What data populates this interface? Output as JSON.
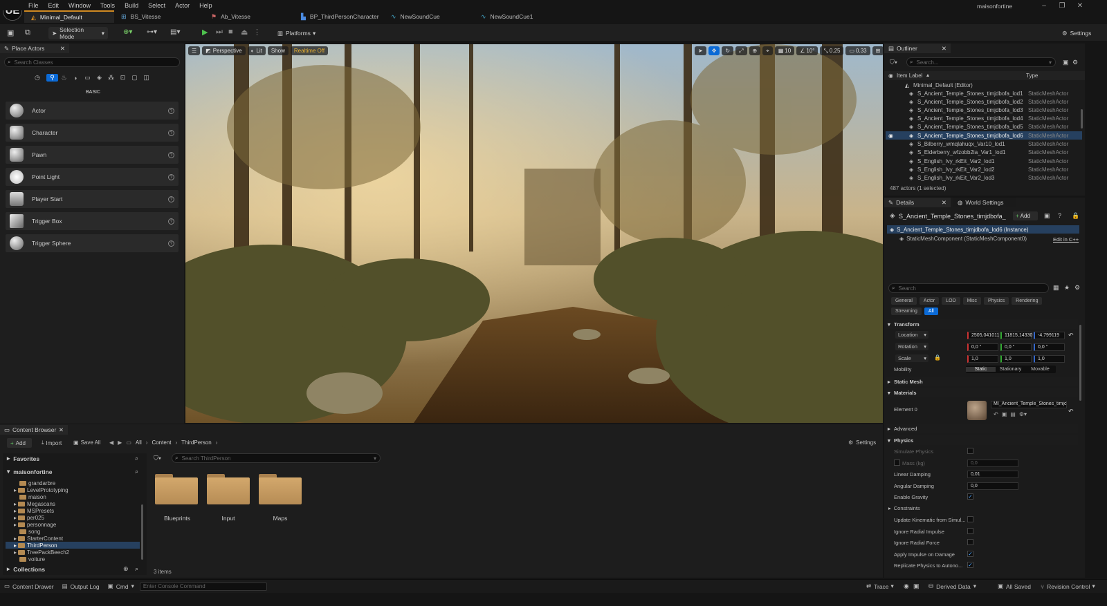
{
  "window": {
    "project_name": "maisonfortine",
    "logo": "UE"
  },
  "menu": [
    "File",
    "Edit",
    "Window",
    "Tools",
    "Build",
    "Select",
    "Actor",
    "Help"
  ],
  "tabs": [
    {
      "label": "Minimal_Default",
      "icon": "level-icon",
      "active": true
    },
    {
      "label": "BS_Vitesse",
      "icon": "blendspace-icon",
      "active": false
    },
    {
      "label": "Ab_Vitesse",
      "icon": "animblueprint-icon",
      "active": false
    },
    {
      "label": "BP_ThirdPersonCharacter",
      "icon": "blueprint-icon",
      "active": false
    },
    {
      "label": "NewSoundCue",
      "icon": "soundcue-icon",
      "active": false
    },
    {
      "label": "NewSoundCue1",
      "icon": "soundcue-icon",
      "active": false
    }
  ],
  "toolbar": {
    "selection_mode": "Selection Mode",
    "platforms": "Platforms",
    "settings": "Settings"
  },
  "place_actors": {
    "title": "Place Actors",
    "search_placeholder": "Search Classes",
    "category": "BASIC",
    "items": [
      "Actor",
      "Character",
      "Pawn",
      "Point Light",
      "Player Start",
      "Trigger Box",
      "Trigger Sphere"
    ]
  },
  "viewport": {
    "perspective": "Perspective",
    "lit": "Lit",
    "show": "Show",
    "realtime": "Realtime Off",
    "grid": "10",
    "angle": "10°",
    "scale": "0.25",
    "camera": "0.33"
  },
  "outliner": {
    "title": "Outliner",
    "search_placeholder": "Search...",
    "col_label": "Item Label",
    "col_type": "Type",
    "root": "Minimal_Default (Editor)",
    "rows": [
      {
        "label": "S_Ancient_Temple_Stones_timjdbofa_lod1",
        "type": "StaticMeshActor"
      },
      {
        "label": "S_Ancient_Temple_Stones_timjdbofa_lod2",
        "type": "StaticMeshActor"
      },
      {
        "label": "S_Ancient_Temple_Stones_timjdbofa_lod3",
        "type": "StaticMeshActor"
      },
      {
        "label": "S_Ancient_Temple_Stones_timjdbofa_lod4",
        "type": "StaticMeshActor"
      },
      {
        "label": "S_Ancient_Temple_Stones_timjdbofa_lod5",
        "type": "StaticMeshActor"
      },
      {
        "label": "S_Ancient_Temple_Stones_timjdbofa_lod6",
        "type": "StaticMeshActor",
        "selected": true
      },
      {
        "label": "S_Bilberry_wmqlahuqx_Var10_lod1",
        "type": "StaticMeshActor"
      },
      {
        "label": "S_Elderberry_wfzobb2ia_Var1_lod1",
        "type": "StaticMeshActor"
      },
      {
        "label": "S_English_Ivy_rkEit_Var2_lod1",
        "type": "StaticMeshActor"
      },
      {
        "label": "S_English_Ivy_rkEit_Var2_lod2",
        "type": "StaticMeshActor"
      },
      {
        "label": "S_English_Ivy_rkEit_Var2_lod3",
        "type": "StaticMeshActor"
      }
    ],
    "status": "487 actors (1 selected)"
  },
  "details": {
    "tab": "Details",
    "world_tab": "World Settings",
    "actor_name": "S_Ancient_Temple_Stones_timjdbofa_",
    "add": "Add",
    "instance": "S_Ancient_Temple_Stones_timjdbofa_lod6 (Instance)",
    "component": "StaticMeshComponent (StaticMeshComponent0)",
    "edit_cpp": "Edit in C++",
    "search_placeholder": "Search",
    "categories": [
      "General",
      "Actor",
      "LOD",
      "Misc",
      "Physics",
      "Rendering"
    ],
    "categories2": [
      "Streaming",
      "All"
    ],
    "transform": "Transform",
    "location_label": "Location",
    "location": [
      "2505,041011",
      "11815,14330",
      "-4,799119"
    ],
    "rotation_label": "Rotation",
    "rotation": [
      "0,0 °",
      "0,0 °",
      "0,0 °"
    ],
    "scale_label": "Scale",
    "scale": [
      "1,0",
      "1,0",
      "1,0"
    ],
    "mobility_label": "Mobility",
    "mobility": [
      "Static",
      "Stationary",
      "Movable"
    ],
    "static_mesh": "Static Mesh",
    "materials": "Materials",
    "element0": "Element 0",
    "material_name": "MI_Ancient_Temple_Stones_timjc",
    "advanced": "Advanced",
    "physics": "Physics",
    "simulate": "Simulate Physics",
    "mass": "Mass (kg)",
    "mass_val": "0,0",
    "linear": "Linear Damping",
    "linear_val": "0,01",
    "angular": "Angular Damping",
    "angular_val": "0,0",
    "gravity": "Enable Gravity",
    "constraints": "Constraints",
    "kinematic": "Update Kinematic from Simul...",
    "radial_impulse": "Ignore Radial Impulse",
    "radial_force": "Ignore Radial Force",
    "impulse_damage": "Apply Impulse on Damage",
    "replicate": "Replicate Physics to Autono..."
  },
  "content_browser": {
    "title": "Content Browser",
    "add": "Add",
    "import": "Import",
    "save_all": "Save All",
    "path": [
      "All",
      "Content",
      "ThirdPerson"
    ],
    "settings": "Settings",
    "favorites": "Favorites",
    "root": "maisonfortine",
    "tree": [
      "grandarbre",
      "LevelPrototyping",
      "maison",
      "Megascans",
      "MSPresets",
      "per025",
      "personnage",
      "song",
      "StarterContent",
      "ThirdPerson",
      "TreePackBeech2",
      "voiture"
    ],
    "selected_folder": "ThirdPerson",
    "search_placeholder": "Search ThirdPerson",
    "folders": [
      "Blueprints",
      "Input",
      "Maps"
    ],
    "count": "3 items",
    "collections": "Collections"
  },
  "statusbar": {
    "content_drawer": "Content Drawer",
    "output_log": "Output Log",
    "cmd": "Cmd",
    "console_placeholder": "Enter Console Command",
    "trace": "Trace",
    "derived": "Derived Data",
    "saved": "All Saved",
    "revision": "Revision Control"
  }
}
